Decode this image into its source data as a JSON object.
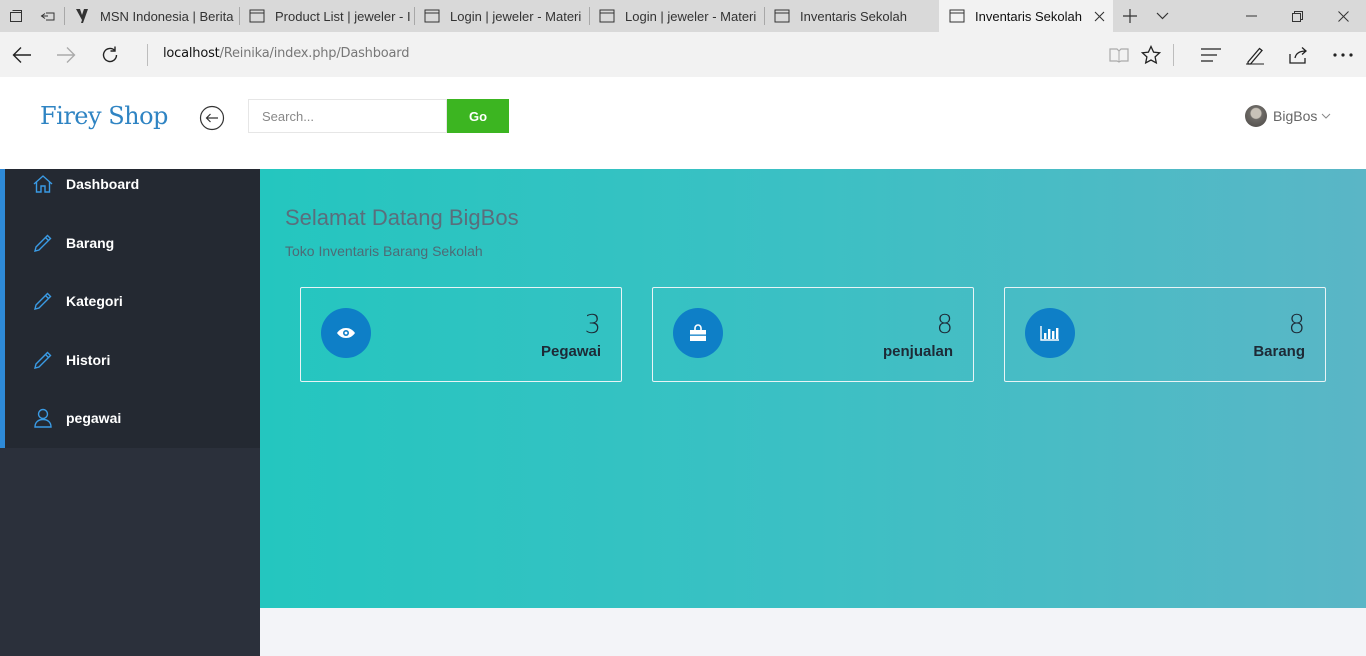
{
  "browser": {
    "tabs": [
      {
        "title": "MSN Indonesia | Berita",
        "icon": "msn-icon",
        "active": false
      },
      {
        "title": "Product List | jeweler - I",
        "icon": "page-icon",
        "active": false
      },
      {
        "title": "Login | jeweler - Materi",
        "icon": "page-icon",
        "active": false
      },
      {
        "title": "Login | jeweler - Materi",
        "icon": "page-icon",
        "active": false
      },
      {
        "title": "Inventaris Sekolah",
        "icon": "page-icon",
        "active": false
      },
      {
        "title": "Inventaris Sekolah",
        "icon": "page-icon",
        "active": true
      }
    ],
    "url_host": "localhost",
    "url_path": "/Reinika/index.php/Dashboard"
  },
  "header": {
    "brand": "Firey Shop",
    "search_placeholder": "Search...",
    "go_label": "Go",
    "username": "BigBos"
  },
  "sidebar": {
    "items": [
      {
        "label": "Dashboard",
        "icon": "home-icon"
      },
      {
        "label": "Barang",
        "icon": "pencil-icon"
      },
      {
        "label": "Kategori",
        "icon": "pencil-icon"
      },
      {
        "label": "Histori",
        "icon": "pencil-icon"
      },
      {
        "label": "pegawai",
        "icon": "user-icon"
      }
    ],
    "accent_color": "#2e8ad8"
  },
  "main": {
    "title": "Selamat Datang BigBos",
    "subtitle": "Toko Inventaris Barang Sekolah",
    "cards": [
      {
        "value": "3",
        "label": "Pegawai",
        "icon": "eye-icon"
      },
      {
        "value": "8",
        "label": "penjualan",
        "icon": "shopping-bag-icon"
      },
      {
        "value": "8",
        "label": "Barang",
        "icon": "bar-chart-icon"
      }
    ]
  },
  "colors": {
    "brand": "#2f84c3",
    "go_button": "#3cb521",
    "card_icon_bg": "#0e7fc7",
    "sidebar_bg": "#2b303b"
  }
}
